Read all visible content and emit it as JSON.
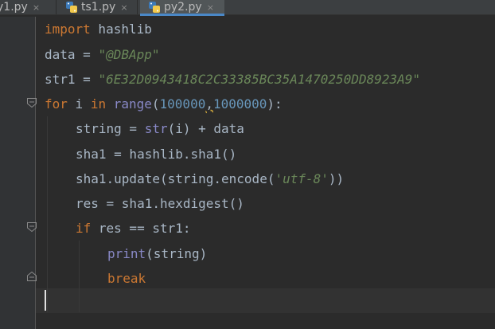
{
  "tabs": [
    {
      "label": "y1.py",
      "active": false
    },
    {
      "label": "ts1.py",
      "active": false
    },
    {
      "label": "py2.py",
      "active": true
    }
  ],
  "close_glyph": "×",
  "code": {
    "l1": {
      "kw": "import",
      "rest": " hashlib"
    },
    "l2": {
      "lhs": "data = ",
      "str": "\"@DBApp\""
    },
    "l3": {
      "lhs": "str1 = ",
      "str": "\"6E32D0943418C2C33385BC35A1470250DD8923A9\""
    },
    "l4": {
      "kw1": "for",
      "mid1": " i ",
      "kw2": "in",
      "sp": " ",
      "fn": "range",
      "p1": "(",
      "n1": "100000",
      "comma": ",",
      "n2": "1000000",
      "p2": "):"
    },
    "l5": {
      "a": "string = ",
      "fn": "str",
      "b": "(i) + data"
    },
    "l6": {
      "a": "sha1 = hashlib.sha1()"
    },
    "l7": {
      "a": "sha1.update(string.encode(",
      "str": "'utf-8'",
      "b": "))"
    },
    "l8": {
      "a": "res = sha1.hexdigest()"
    },
    "l9": {
      "kw": "if",
      "rest": " res == str1:"
    },
    "l10": {
      "fn": "print",
      "rest": "(string)"
    },
    "l11": {
      "kw": "break"
    }
  },
  "colors": {
    "background": "#2b2b2b",
    "keyword": "#cc7832",
    "string": "#6a8759",
    "number": "#6897bb",
    "builtin": "#8888c6",
    "text": "#a9b7c6",
    "tab_accent": "#4a88c7"
  }
}
